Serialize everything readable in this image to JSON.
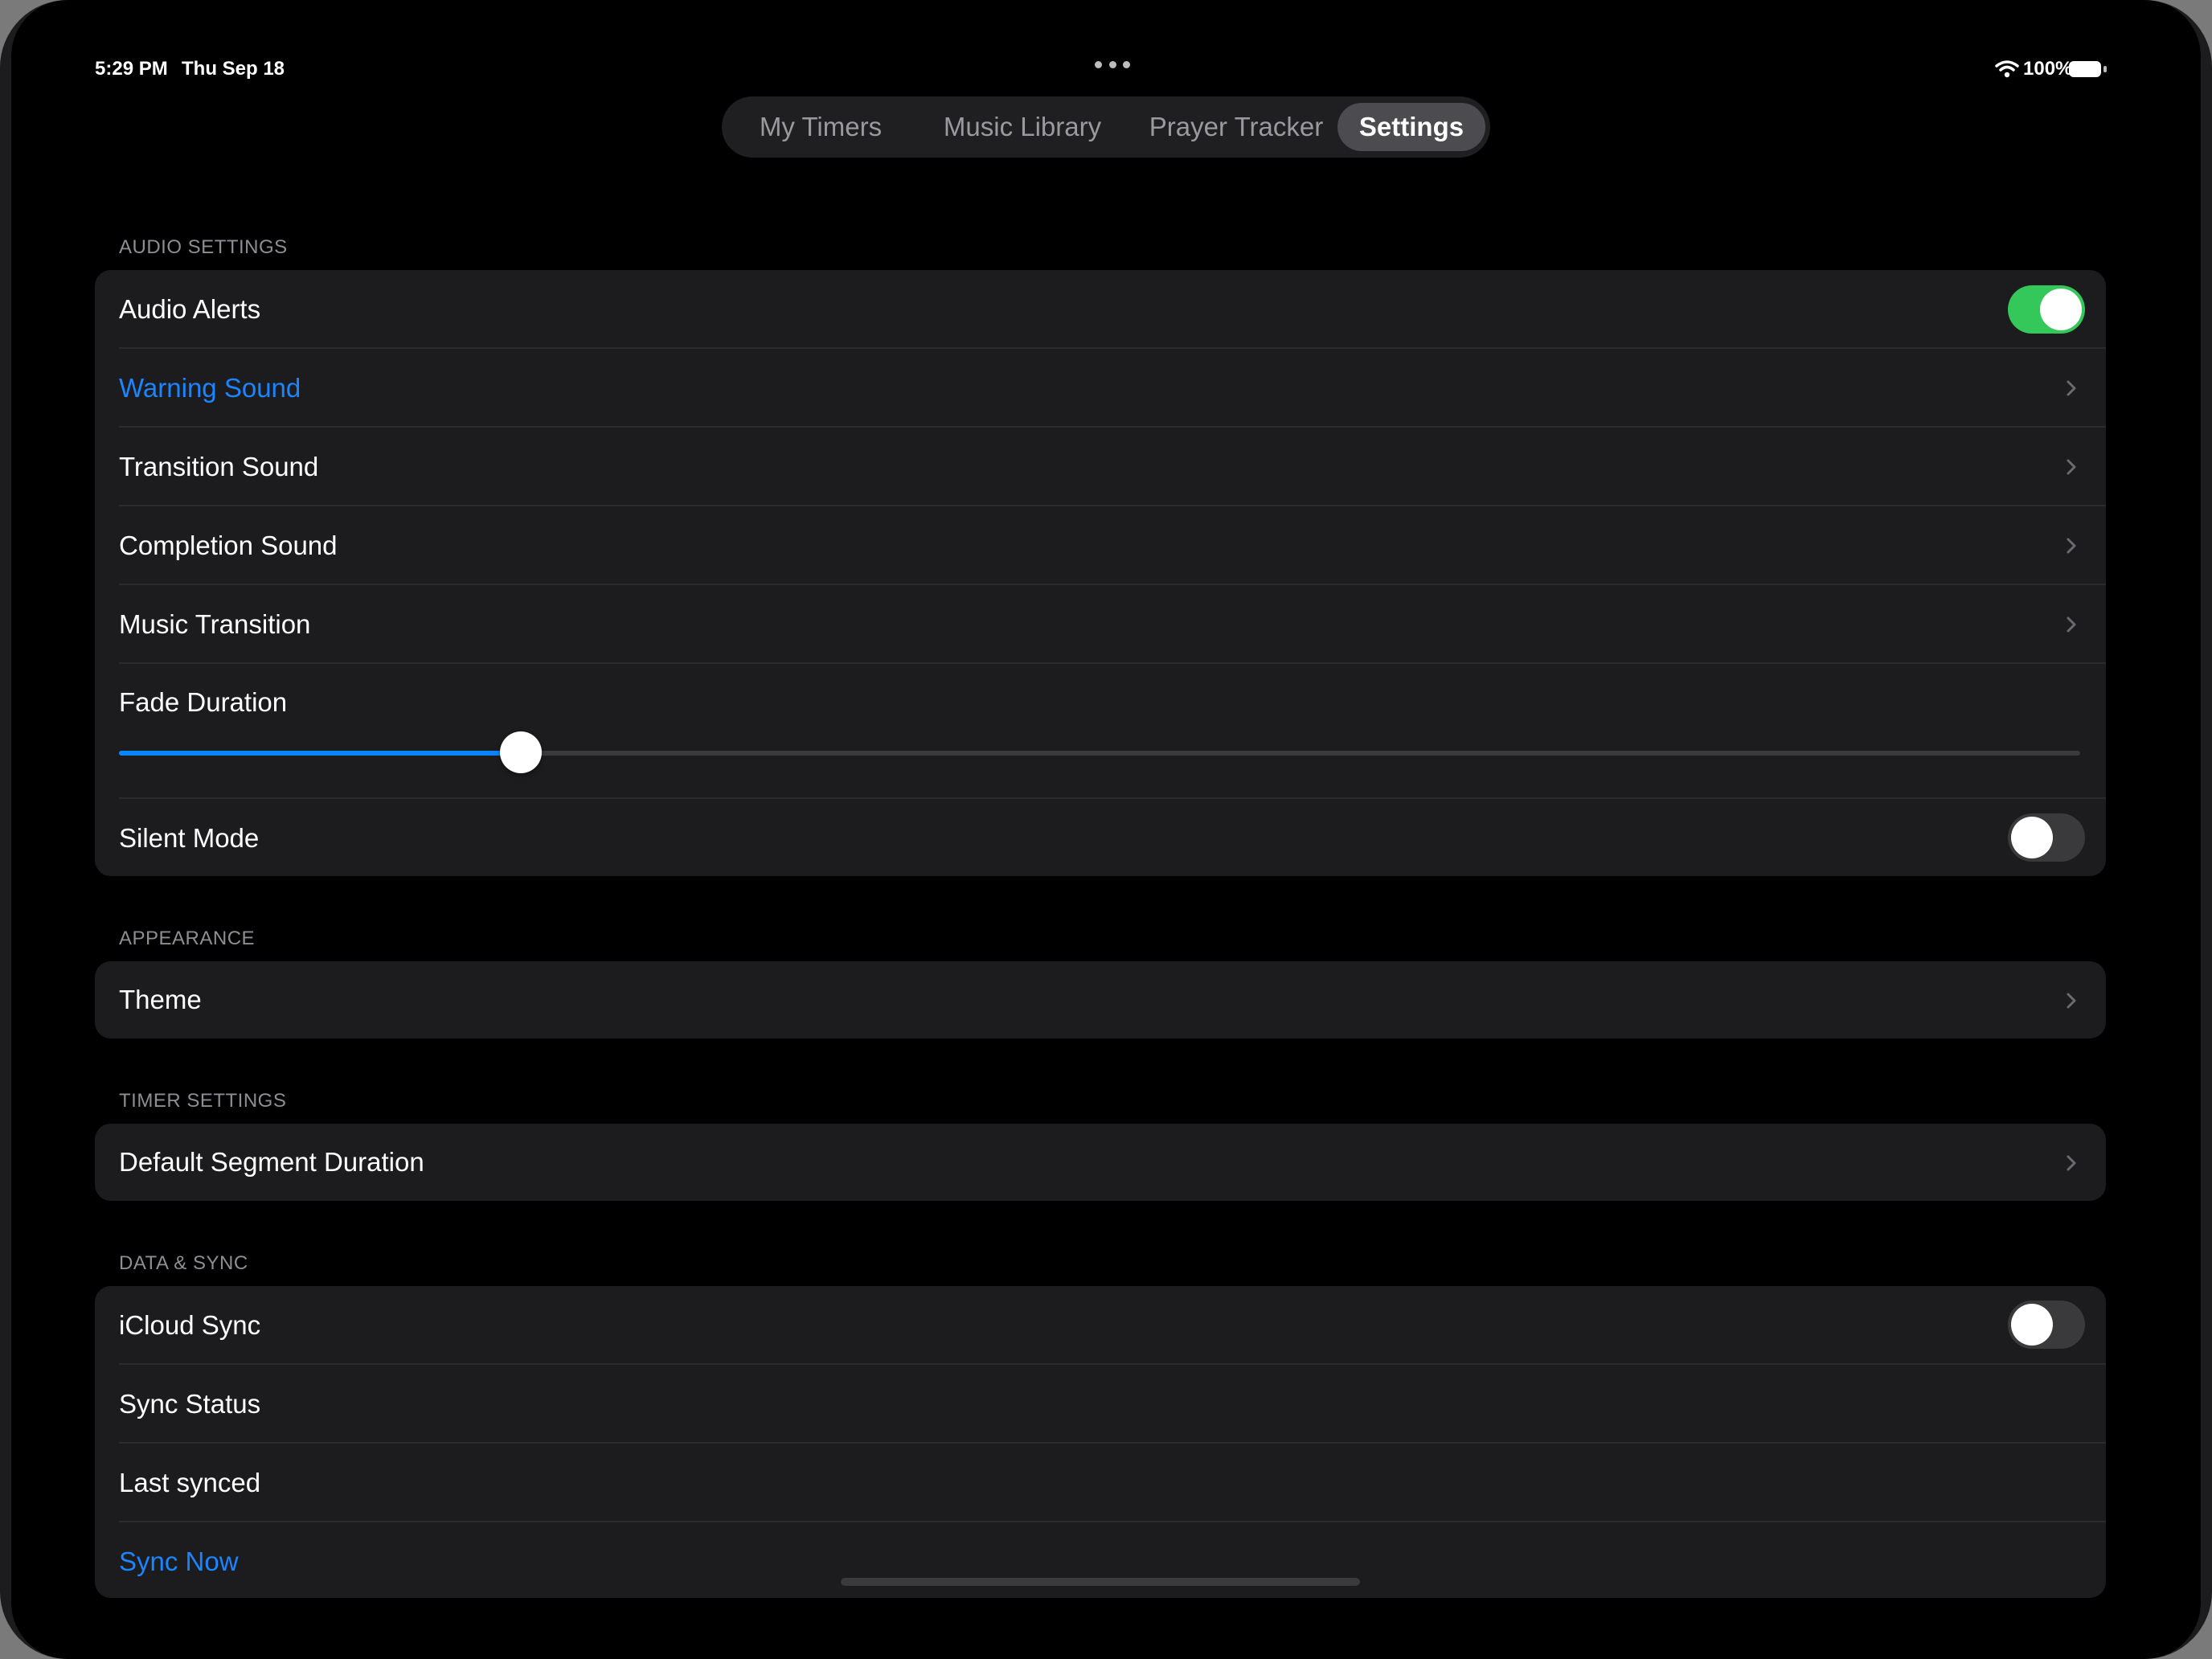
{
  "status_bar": {
    "time": "5:29 PM",
    "date": "Thu Sep 18",
    "battery_percent": "100%"
  },
  "tabs": [
    {
      "label": "My Timers",
      "active": false
    },
    {
      "label": "Music Library",
      "active": false
    },
    {
      "label": "Prayer Tracker",
      "active": false
    },
    {
      "label": "Settings",
      "active": true
    }
  ],
  "sections": {
    "audio": {
      "header": "AUDIO SETTINGS",
      "audio_alerts": {
        "label": "Audio Alerts",
        "on": true
      },
      "warning_sound": {
        "label": "Warning Sound"
      },
      "transition_sound": {
        "label": "Transition Sound"
      },
      "completion_sound": {
        "label": "Completion Sound"
      },
      "music_transition": {
        "label": "Music Transition"
      },
      "fade_duration": {
        "label": "Fade Duration",
        "slider_fraction": 0.205
      },
      "silent_mode": {
        "label": "Silent Mode",
        "on": false
      }
    },
    "appearance": {
      "header": "APPEARANCE",
      "theme": {
        "label": "Theme"
      }
    },
    "timer": {
      "header": "TIMER SETTINGS",
      "default_segment": {
        "label": "Default Segment Duration"
      }
    },
    "data_sync": {
      "header": "DATA & SYNC",
      "icloud_sync": {
        "label": "iCloud Sync",
        "on": false
      },
      "sync_status": {
        "label": "Sync Status"
      },
      "last_synced": {
        "label": "Last synced"
      },
      "sync_now": {
        "label": "Sync Now"
      }
    }
  },
  "colors": {
    "accent": "#1b84ff",
    "toggle_on": "#34c759",
    "background": "#000000",
    "group_background": "#1c1c1e"
  },
  "icons": [
    "wifi-icon",
    "battery-icon",
    "more-dots-icon",
    "chevron-right-icon"
  ]
}
